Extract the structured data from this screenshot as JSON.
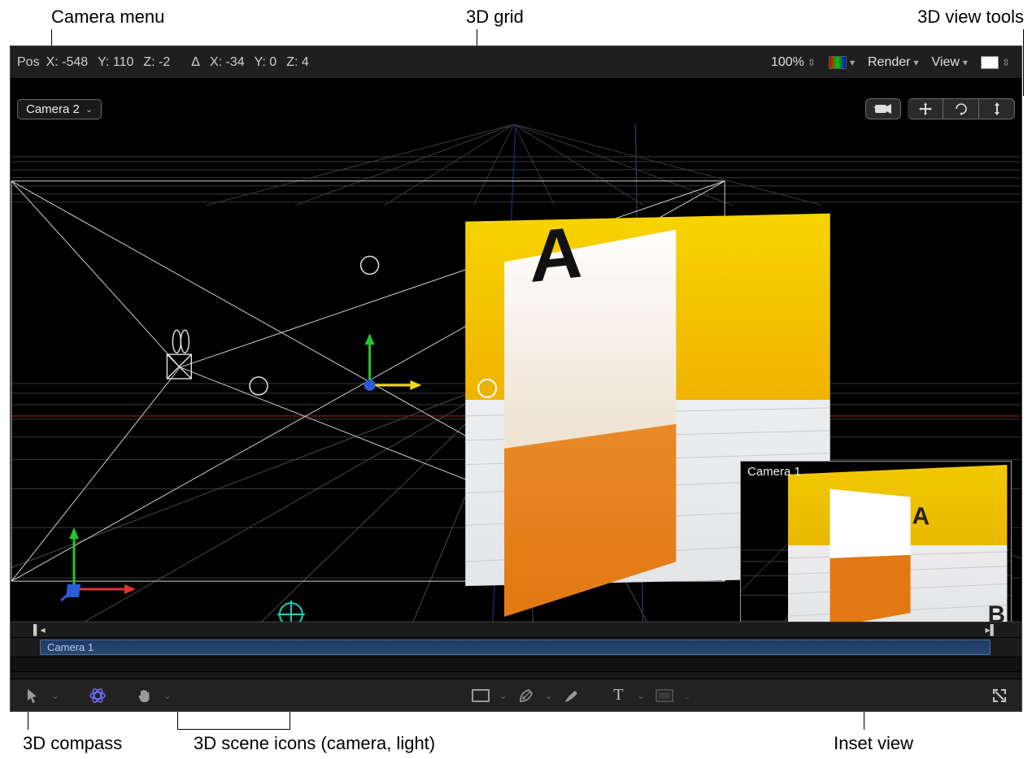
{
  "annotations": {
    "camera_menu": "Camera menu",
    "grid": "3D grid",
    "view_tools": "3D view tools",
    "compass": "3D compass",
    "scene_icons": "3D scene icons (camera, light)",
    "inset": "Inset view"
  },
  "topbar": {
    "pos_label": "Pos",
    "x": "X: -548",
    "y": "Y: 110",
    "z": "Z: -2",
    "delta": "Δ",
    "dx": "X: -34",
    "dy": "Y: 0",
    "dz": "Z: 4",
    "zoom": "100%",
    "render": "Render",
    "view": "View"
  },
  "camera_menu": {
    "label": "Camera 2"
  },
  "inset": {
    "label": "Camera 1",
    "letter_a": "A",
    "letter_b": "B"
  },
  "timeline": {
    "clip_name": "Camera 1"
  },
  "scene": {
    "letter": "A"
  },
  "colors": {
    "axis_x": "#d33",
    "axis_y": "#29c32c",
    "axis_z": "#2b5bd6",
    "grid": "#3c3c3c",
    "grid_major": "#5c5c5c",
    "frustum": "#cfcfcf",
    "light": "#17d1c3",
    "plane_top": "#fedb00",
    "plane_bottom": "#ec8a16"
  }
}
